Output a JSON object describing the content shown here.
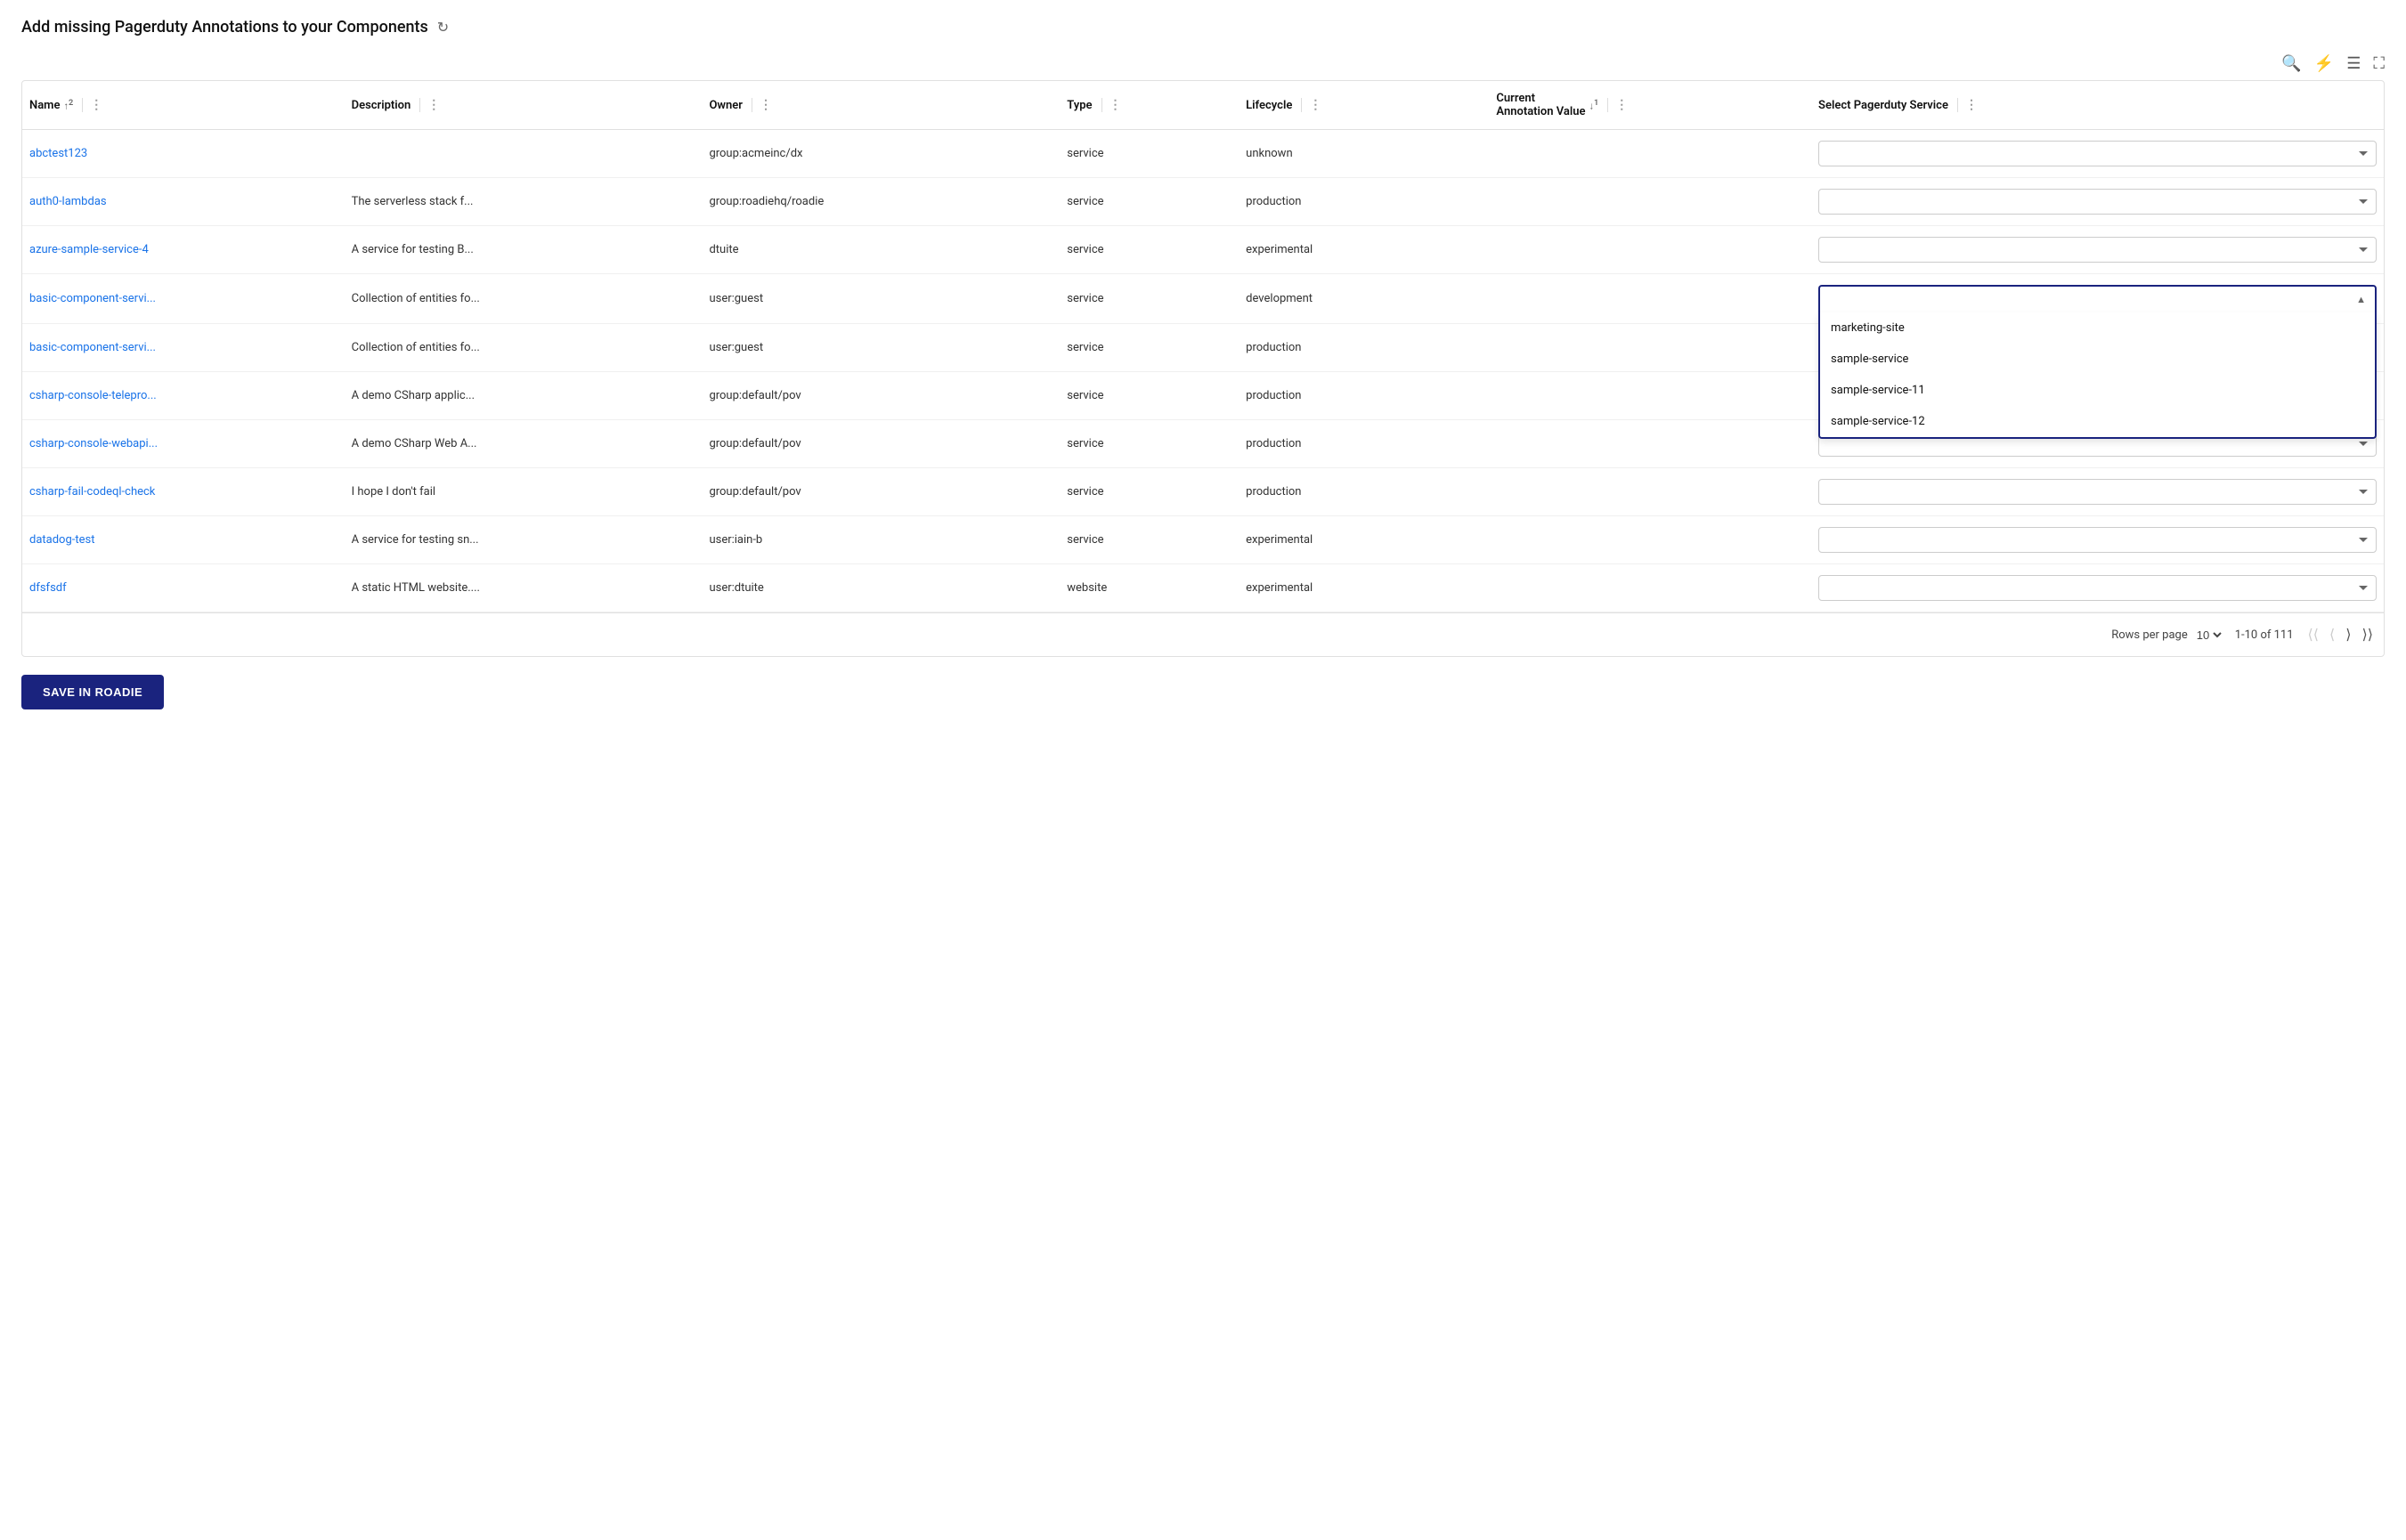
{
  "header": {
    "title": "Add missing Pagerduty Annotations to your Components",
    "refresh_label": "refresh"
  },
  "toolbar": {
    "search_icon": "🔍",
    "filter_icon": "⚡",
    "menu_icon": "☰",
    "expand_icon": "⛶"
  },
  "columns": [
    {
      "id": "name",
      "label": "Name",
      "sort": "↑",
      "sort_count": "2"
    },
    {
      "id": "description",
      "label": "Description"
    },
    {
      "id": "owner",
      "label": "Owner"
    },
    {
      "id": "type",
      "label": "Type"
    },
    {
      "id": "lifecycle",
      "label": "Lifecycle"
    },
    {
      "id": "annotation",
      "label": "Current Annotation Value",
      "sort": "↓",
      "sort_count": "1"
    },
    {
      "id": "select",
      "label": "Select Pagerduty Service"
    }
  ],
  "rows": [
    {
      "name": "abctest123",
      "description": "",
      "owner": "group:acmeinc/dx",
      "type": "service",
      "lifecycle": "unknown",
      "selected": ""
    },
    {
      "name": "auth0-lambdas",
      "description": "The serverless stack f...",
      "owner": "group:roadiehq/roadie",
      "type": "service",
      "lifecycle": "production",
      "selected": ""
    },
    {
      "name": "azure-sample-service-4",
      "description": "A service for testing B...",
      "owner": "dtuite",
      "type": "service",
      "lifecycle": "experimental",
      "selected": ""
    },
    {
      "name": "basic-component-servi...",
      "description": "Collection of entities fo...",
      "owner": "user:guest",
      "type": "service",
      "lifecycle": "development",
      "selected": "",
      "open": true
    },
    {
      "name": "basic-component-servi...",
      "description": "Collection of entities fo...",
      "owner": "user:guest",
      "type": "service",
      "lifecycle": "production",
      "selected": ""
    },
    {
      "name": "csharp-console-telepro...",
      "description": "A demo CSharp applic...",
      "owner": "group:default/pov",
      "type": "service",
      "lifecycle": "production",
      "selected": ""
    },
    {
      "name": "csharp-console-webapi...",
      "description": "A demo CSharp Web A...",
      "owner": "group:default/pov",
      "type": "service",
      "lifecycle": "production",
      "selected": ""
    },
    {
      "name": "csharp-fail-codeql-check",
      "description": "I hope I don't fail",
      "owner": "group:default/pov",
      "type": "service",
      "lifecycle": "production",
      "selected": ""
    },
    {
      "name": "datadog-test",
      "description": "A service for testing sn...",
      "owner": "user:iain-b",
      "type": "service",
      "lifecycle": "experimental",
      "selected": ""
    },
    {
      "name": "dfsfsdf",
      "description": "A static HTML website....",
      "owner": "user:dtuite",
      "type": "website",
      "lifecycle": "experimental",
      "selected": ""
    }
  ],
  "dropdown_options": [
    "marketing-site",
    "sample-service",
    "sample-service-11",
    "sample-service-12"
  ],
  "footer": {
    "rows_per_page_label": "Rows per page",
    "rows_per_page_value": "10",
    "pagination_info": "1-10 of 111"
  },
  "save_button": "SAVE IN ROADIE"
}
